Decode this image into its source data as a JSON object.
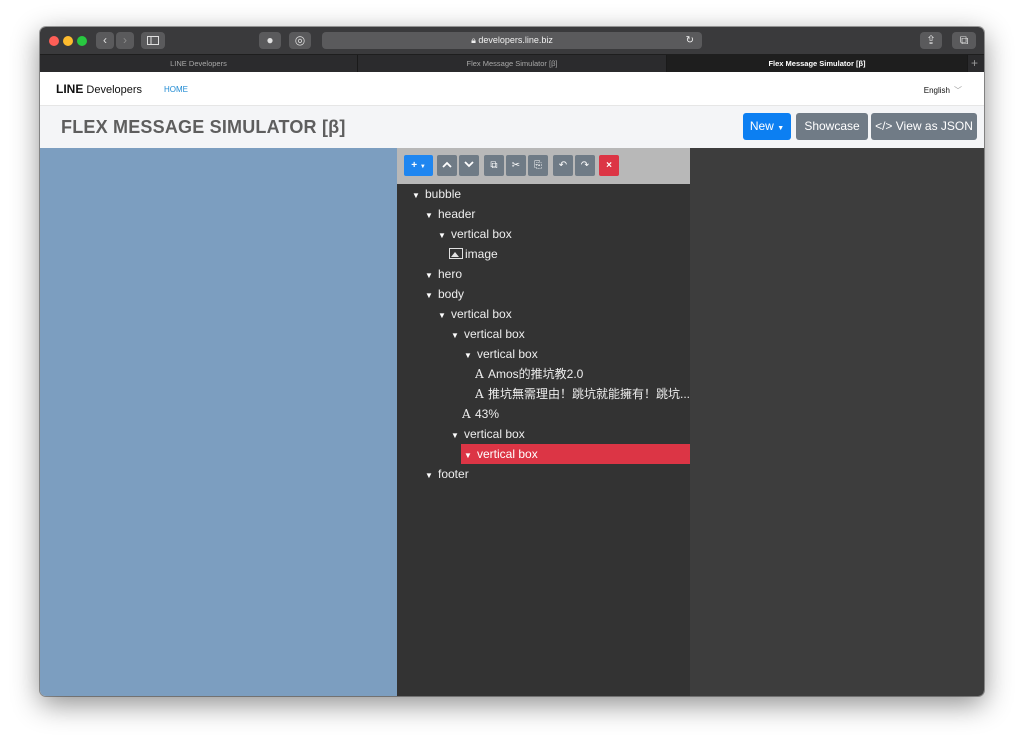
{
  "browser": {
    "address": "developers.line.biz",
    "tabs": [
      {
        "label": "LINE Developers"
      },
      {
        "label": "Flex Message Simulator [β]"
      },
      {
        "label": "Flex Message Simulator [β]"
      }
    ]
  },
  "site": {
    "logo_bold": "LINE",
    "logo_rest": "Developers",
    "home": "HOME",
    "language": "English"
  },
  "page": {
    "title": "FLEX MESSAGE SIMULATOR [β]",
    "new_label": "New",
    "showcase_label": "Showcase",
    "json_label": "</> View as JSON"
  },
  "toolbar": {
    "add": "+",
    "up": "^",
    "down": "v",
    "copy": "⧉",
    "cut": "✂",
    "paste": "⎘",
    "undo": "↶",
    "redo": "↷",
    "delete": "×"
  },
  "tree": [
    {
      "label": "bubble"
    },
    {
      "label": "header"
    },
    {
      "label": "vertical box"
    },
    {
      "label": "image"
    },
    {
      "label": "hero"
    },
    {
      "label": "body"
    },
    {
      "label": "vertical box"
    },
    {
      "label": "vertical box"
    },
    {
      "label": "vertical box"
    },
    {
      "label": "Amos的推坑教2.0"
    },
    {
      "label": "推坑無需理由！跳坑就能擁有！跳坑..."
    },
    {
      "label": "43%"
    },
    {
      "label": "vertical box"
    },
    {
      "label": "vertical box"
    },
    {
      "label": "footer"
    }
  ],
  "colors": {
    "accent": "#0c7ff2",
    "selected": "#dc3545",
    "preview_bg": "#7c9ec0"
  }
}
